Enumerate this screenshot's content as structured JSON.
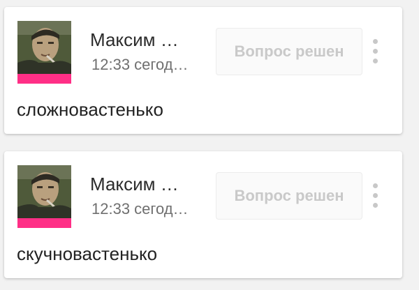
{
  "comments": [
    {
      "author": "Максим …",
      "time": "12:33 сегод…",
      "resolve_label": "Вопрос решен",
      "text": "сложновастенько",
      "menu_icon": "more-vertical-icon"
    },
    {
      "author": "Максим …",
      "time": "12:33 сегод…",
      "resolve_label": "Вопрос решен",
      "text": "скучновастенько",
      "menu_icon": "more-vertical-icon"
    }
  ],
  "colors": {
    "avatar_strip": "#ff2f86",
    "disabled_text": "#c9c9c9"
  }
}
